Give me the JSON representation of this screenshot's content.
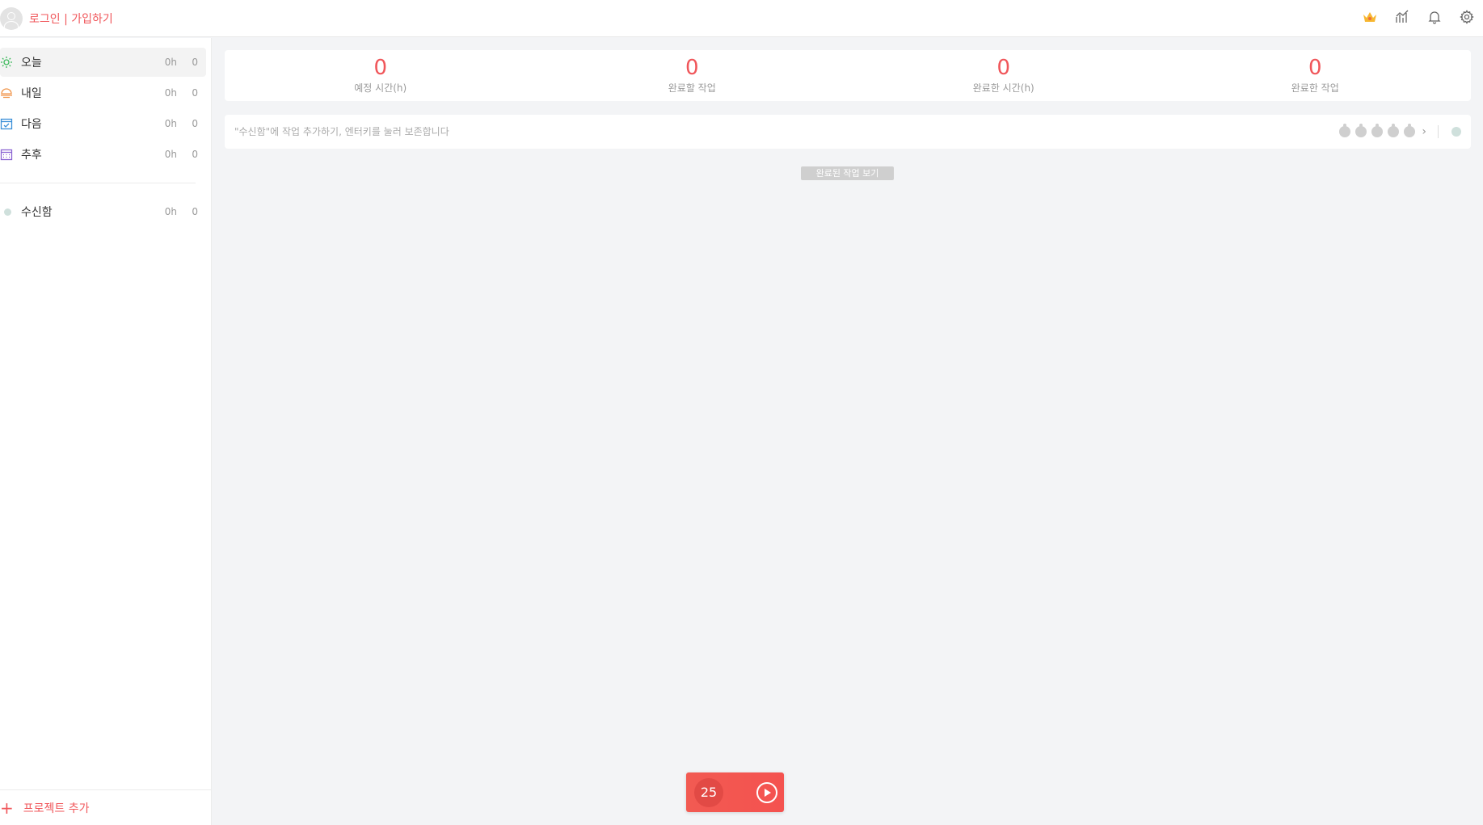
{
  "header": {
    "login_text": "로그인 | 가입하기",
    "icons": [
      "crown-icon",
      "statistics-icon",
      "bell-icon",
      "gear-icon"
    ],
    "accent_color": "#f0565a"
  },
  "sidebar": {
    "items": [
      {
        "label": "오늘",
        "hours": "0h",
        "count": "0",
        "icon": "sun-icon"
      },
      {
        "label": "내일",
        "hours": "0h",
        "count": "0",
        "icon": "sunset-icon"
      },
      {
        "label": "다음",
        "hours": "0h",
        "count": "0",
        "icon": "calendar-check-icon"
      },
      {
        "label": "추후",
        "hours": "0h",
        "count": "0",
        "icon": "calendar-icon"
      }
    ],
    "inbox": {
      "label": "수신함",
      "hours": "0h",
      "count": "0"
    },
    "add_project": "프로젝트 추가"
  },
  "stats": [
    {
      "value": "0",
      "label": "예정 시간(h)"
    },
    {
      "value": "0",
      "label": "완료할 작업"
    },
    {
      "value": "0",
      "label": "완료한 시간(h)"
    },
    {
      "value": "0",
      "label": "완료한 작업"
    }
  ],
  "task_input": {
    "placeholder": "\"수신함\"에 작업 추가하기, 엔터키를 눌러 보존합니다"
  },
  "show_completed": "완료된 작업 보기",
  "pomodoro": {
    "count": "25"
  }
}
